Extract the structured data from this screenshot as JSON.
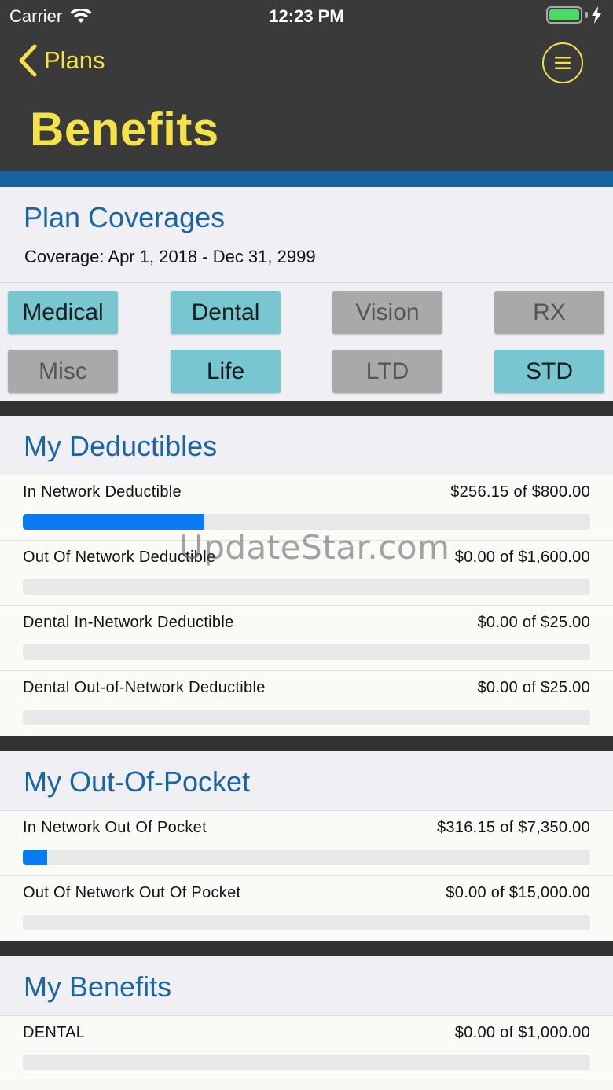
{
  "status_bar": {
    "carrier": "Carrier",
    "time": "12:23 PM"
  },
  "nav": {
    "back_label": "Plans",
    "title": "Benefits"
  },
  "coverage": {
    "title": "Plan Coverages",
    "dates": "Coverage: Apr 1, 2018 - Dec 31, 2999"
  },
  "tabs": [
    {
      "label": "Medical",
      "active": true
    },
    {
      "label": "Dental",
      "active": true
    },
    {
      "label": "Vision",
      "active": false
    },
    {
      "label": "RX",
      "active": false
    },
    {
      "label": "Misc",
      "active": false
    },
    {
      "label": "Life",
      "active": true
    },
    {
      "label": "LTD",
      "active": false
    },
    {
      "label": "STD",
      "active": true
    }
  ],
  "deductibles": {
    "title": "My Deductibles",
    "rows": [
      {
        "label": "In Network Deductible",
        "value": "$256.15 of $800.00",
        "progress": 0.32
      },
      {
        "label": "Out Of Network Deductible",
        "value": "$0.00 of $1,600.00",
        "progress": 0
      },
      {
        "label": "Dental In-Network Deductible",
        "value": "$0.00 of $25.00",
        "progress": 0
      },
      {
        "label": "Dental Out-of-Network Deductible",
        "value": "$0.00 of $25.00",
        "progress": 0
      }
    ]
  },
  "out_of_pocket": {
    "title": "My Out-Of-Pocket",
    "rows": [
      {
        "label": "In Network Out Of Pocket",
        "value": "$316.15 of $7,350.00",
        "progress": 0.043
      },
      {
        "label": "Out Of Network Out Of Pocket",
        "value": "$0.00 of $15,000.00",
        "progress": 0
      }
    ]
  },
  "benefits": {
    "title": "My Benefits",
    "rows": [
      {
        "label": "DENTAL",
        "value": "$0.00 of $1,000.00",
        "progress": 0
      }
    ]
  },
  "watermark": "UpdateStar.com",
  "colors": {
    "header_bg": "#3a3a3a",
    "accent_yellow": "#f3e24a",
    "section_title_blue": "#1a66a0",
    "tab_active": "#78c6cf",
    "tab_inactive": "#a9a9a9",
    "progress_fill": "#0a7af2"
  }
}
